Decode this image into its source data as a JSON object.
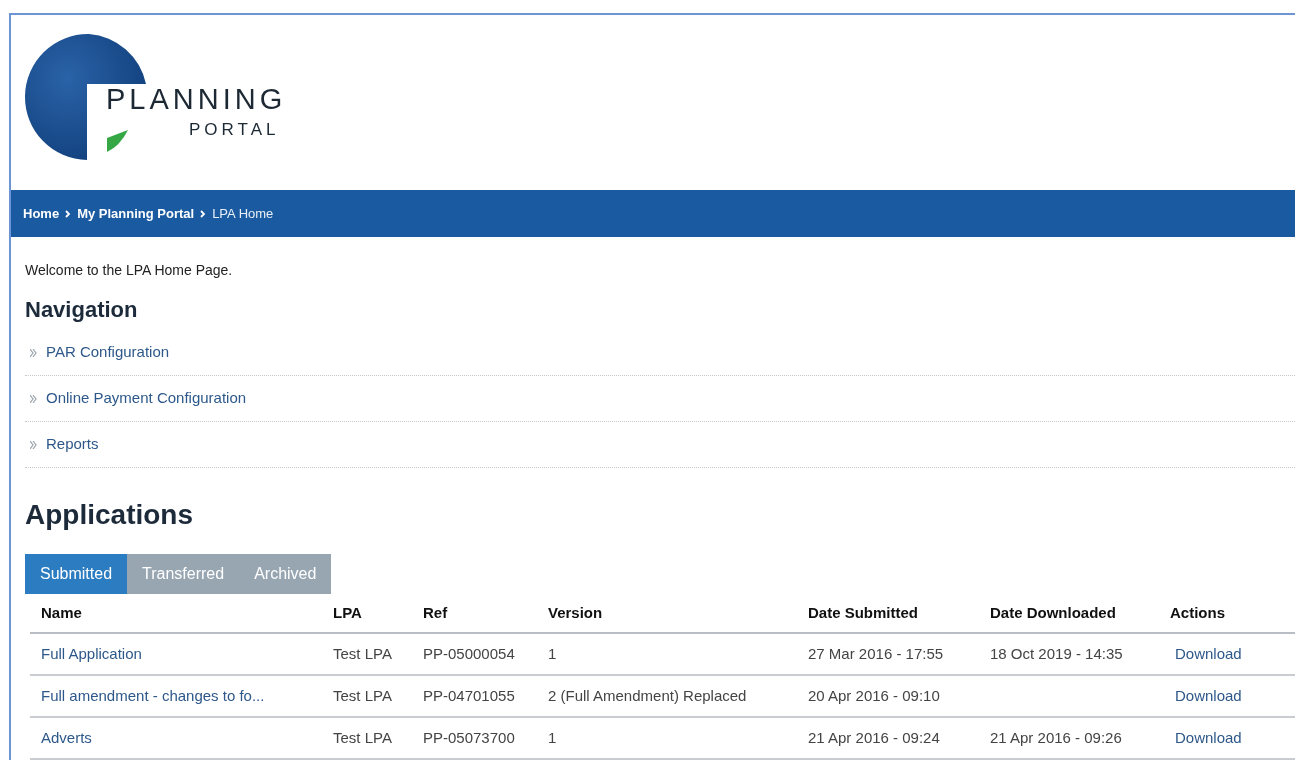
{
  "logo": {
    "line_1": "PLANNING",
    "line_2": "PORTAL"
  },
  "breadcrumb": [
    {
      "label": "Home",
      "current": false
    },
    {
      "label": "My Planning Portal",
      "current": false
    },
    {
      "label": "LPA Home",
      "current": true
    }
  ],
  "welcome": "Welcome to the LPA Home Page.",
  "navigation": {
    "title": "Navigation",
    "items": [
      "PAR Configuration",
      "Online Payment Configuration",
      "Reports"
    ]
  },
  "applications": {
    "title": "Applications",
    "tabs": [
      {
        "label": "Submitted",
        "selected": true
      },
      {
        "label": "Transferred",
        "selected": false
      },
      {
        "label": "Archived",
        "selected": false
      }
    ],
    "table": {
      "columns": [
        "Name",
        "LPA",
        "Ref",
        "Version",
        "Date Submitted",
        "Date Downloaded",
        "Actions"
      ],
      "rows": [
        {
          "name": "Full Application",
          "lpa": "Test LPA",
          "ref": "PP-05000054",
          "version": "1",
          "date_submitted": "27 Mar 2016 - 17:55",
          "date_downloaded": "18 Oct 2019 - 14:35",
          "action": "Download"
        },
        {
          "name": "Full amendment - changes to fo...",
          "lpa": "Test LPA",
          "ref": "PP-04701055",
          "version": "2 (Full Amendment) Replaced",
          "date_submitted": "20 Apr 2016 - 09:10",
          "action": "Download"
        },
        {
          "name": "Adverts",
          "lpa": "Test LPA",
          "ref": "PP-05073700",
          "version": "1",
          "date_submitted": "21 Apr 2016 - 09:24",
          "date_downloaded": "21 Apr 2016 - 09:26",
          "action": "Download"
        }
      ]
    }
  }
}
